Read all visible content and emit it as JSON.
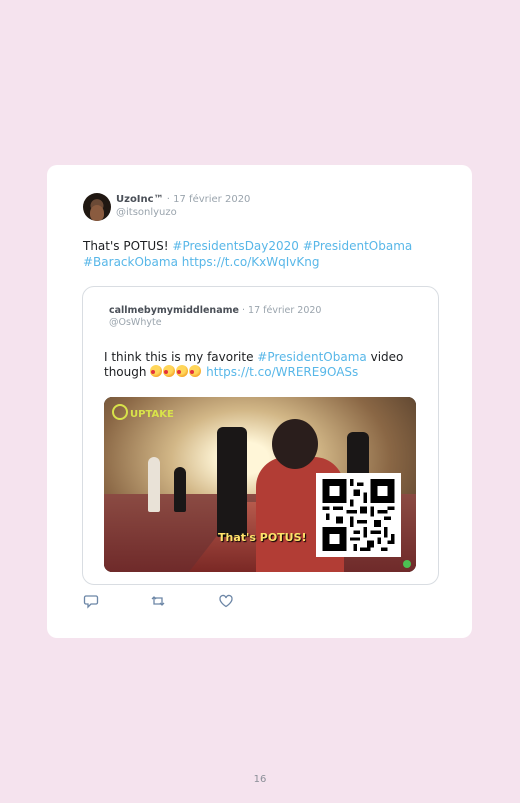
{
  "tweet": {
    "author_name": "UzoInc™",
    "separator": "·",
    "date": "17 février 2020",
    "handle": "@itsonlyuzo",
    "text_plain": "That's POTUS! ",
    "hashtags": [
      "#PresidentsDay2020",
      "#PresidentObama",
      "#BarackObama"
    ],
    "link": "https://t.co/KxWqIvKng"
  },
  "quoted": {
    "author_name": "callmebymymiddlename",
    "separator": "·",
    "date": "17 février 2020",
    "handle": "@OsWhyte",
    "text_before": "I think this is my favorite ",
    "hashtag": "#PresidentObama",
    "text_after": " video though ",
    "emoji_count": 4,
    "link": "https://t.co/WRERE9OASs",
    "media": {
      "logo": "UPTAKE",
      "caption": "That's POTUS!"
    }
  },
  "actions": {
    "icons": [
      "reply-icon",
      "retweet-icon",
      "like-icon"
    ]
  },
  "page": {
    "number": "16"
  },
  "colors": {
    "background": "#f5e3ee",
    "card": "#ffffff",
    "link": "#58b7e8"
  }
}
